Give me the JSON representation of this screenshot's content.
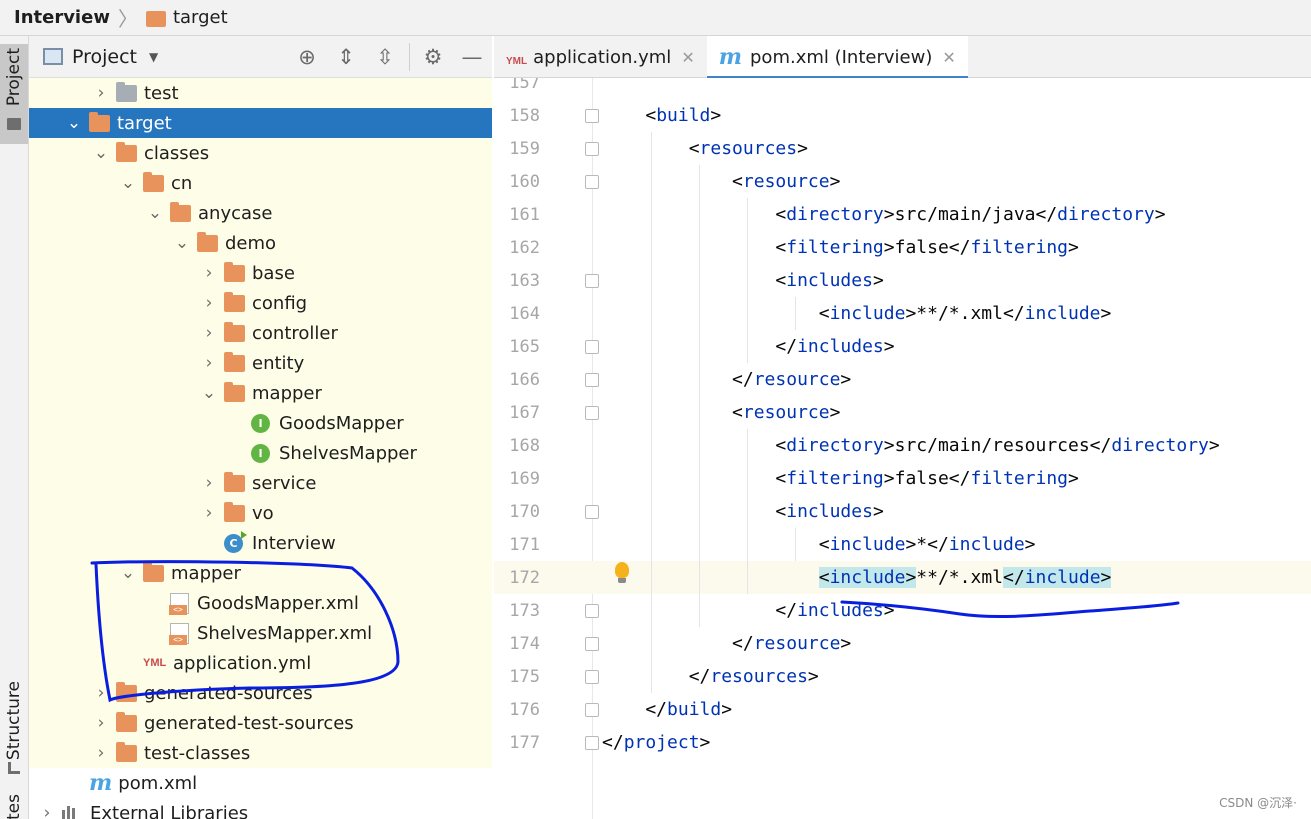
{
  "breadcrumb": {
    "project": "Interview",
    "separator": "〉",
    "folder": "target"
  },
  "tool_stripe": {
    "project_label": "Project",
    "structure_label": "Structure",
    "bottom_label": "tes"
  },
  "project_panel": {
    "title": "Project",
    "tree": [
      {
        "label": "test",
        "arrow": "›",
        "icon": "folder-gray",
        "depth": 1
      },
      {
        "label": "target",
        "arrow": "⌄",
        "icon": "folder",
        "depth": 0,
        "selected": true
      },
      {
        "label": "classes",
        "arrow": "⌄",
        "icon": "folder",
        "depth": 1
      },
      {
        "label": "cn",
        "arrow": "⌄",
        "icon": "folder",
        "depth": 2
      },
      {
        "label": "anycase",
        "arrow": "⌄",
        "icon": "folder",
        "depth": 3
      },
      {
        "label": "demo",
        "arrow": "⌄",
        "icon": "folder",
        "depth": 4
      },
      {
        "label": "base",
        "arrow": "›",
        "icon": "folder",
        "depth": 5
      },
      {
        "label": "config",
        "arrow": "›",
        "icon": "folder",
        "depth": 5
      },
      {
        "label": "controller",
        "arrow": "›",
        "icon": "folder",
        "depth": 5
      },
      {
        "label": "entity",
        "arrow": "›",
        "icon": "folder",
        "depth": 5
      },
      {
        "label": "mapper",
        "arrow": "⌄",
        "icon": "folder",
        "depth": 5
      },
      {
        "label": "GoodsMapper",
        "arrow": "",
        "icon": "interface",
        "depth": 6
      },
      {
        "label": "ShelvesMapper",
        "arrow": "",
        "icon": "interface",
        "depth": 6
      },
      {
        "label": "service",
        "arrow": "›",
        "icon": "folder",
        "depth": 5
      },
      {
        "label": "vo",
        "arrow": "›",
        "icon": "folder",
        "depth": 5
      },
      {
        "label": "Interview",
        "arrow": "",
        "icon": "class",
        "depth": 5
      },
      {
        "label": "mapper",
        "arrow": "⌄",
        "icon": "folder",
        "depth": 2
      },
      {
        "label": "GoodsMapper.xml",
        "arrow": "",
        "icon": "xml",
        "depth": 3
      },
      {
        "label": "ShelvesMapper.xml",
        "arrow": "",
        "icon": "xml",
        "depth": 3
      },
      {
        "label": "application.yml",
        "arrow": "",
        "icon": "yml",
        "depth": 2
      },
      {
        "label": "generated-sources",
        "arrow": "›",
        "icon": "folder",
        "depth": 1
      },
      {
        "label": "generated-test-sources",
        "arrow": "›",
        "icon": "folder",
        "depth": 1
      },
      {
        "label": "test-classes",
        "arrow": "›",
        "icon": "folder",
        "depth": 1
      },
      {
        "label": "pom.xml",
        "arrow": "",
        "icon": "maven",
        "depth": 0,
        "plain": true
      },
      {
        "label": "External Libraries",
        "arrow": "›",
        "icon": "library",
        "depth": -1,
        "plain": true
      }
    ]
  },
  "editor": {
    "tabs": [
      {
        "label": "application.yml",
        "icon": "YML",
        "active": false
      },
      {
        "label": "pom.xml (Interview)",
        "icon": "m",
        "active": true
      }
    ],
    "lines": [
      {
        "n": "157",
        "code": ""
      },
      {
        "n": "158",
        "code": "    <build>"
      },
      {
        "n": "159",
        "code": "        <resources>"
      },
      {
        "n": "160",
        "code": "            <resource>"
      },
      {
        "n": "161",
        "code": "                <directory>src/main/java</directory>"
      },
      {
        "n": "162",
        "code": "                <filtering>false</filtering>"
      },
      {
        "n": "163",
        "code": "                <includes>"
      },
      {
        "n": "164",
        "code": "                    <include>**/*.xml</include>"
      },
      {
        "n": "165",
        "code": "                </includes>"
      },
      {
        "n": "166",
        "code": "            </resource>"
      },
      {
        "n": "167",
        "code": "            <resource>"
      },
      {
        "n": "168",
        "code": "                <directory>src/main/resources</directory>"
      },
      {
        "n": "169",
        "code": "                <filtering>false</filtering>"
      },
      {
        "n": "170",
        "code": "                <includes>"
      },
      {
        "n": "171",
        "code": "                    <include>*</include>"
      },
      {
        "n": "172",
        "code": "                    <include>**/*.xml</include>",
        "current": true
      },
      {
        "n": "173",
        "code": "                </includes>"
      },
      {
        "n": "174",
        "code": "            </resource>"
      },
      {
        "n": "175",
        "code": "        </resources>"
      },
      {
        "n": "176",
        "code": "    </build>"
      },
      {
        "n": "177",
        "code": "</project>"
      }
    ]
  },
  "watermark": "CSDN @沉泽·",
  "colors": {
    "selection": "#2675bf",
    "tree_bg": "#fefde8",
    "xml_tag": "#0033b3",
    "annotation": "#0a1ee0",
    "folder": "#e8935b"
  }
}
